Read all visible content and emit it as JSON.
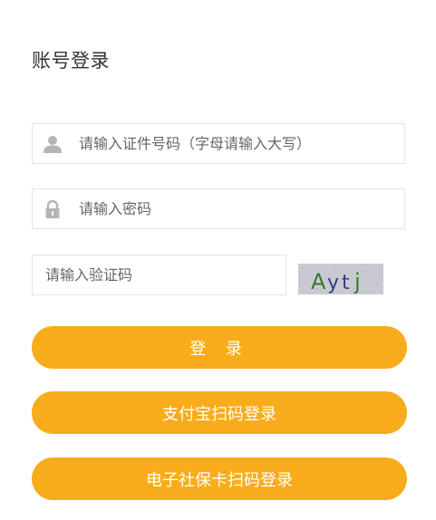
{
  "title": "账号登录",
  "form": {
    "id_placeholder": "请输入证件号码（字母请输入大写）",
    "password_placeholder": "请输入密码",
    "captcha_placeholder": "请输入验证码",
    "captcha_text": "Aytj"
  },
  "buttons": {
    "login": "登 录",
    "alipay": "支付宝扫码登录",
    "social_card": "电子社保卡扫码登录"
  },
  "icons": {
    "user": "user-icon",
    "lock": "lock-icon"
  },
  "colors": {
    "accent": "#f9ac1b",
    "text": "#333333",
    "placeholder": "#666666",
    "border": "#e4e4e4"
  }
}
